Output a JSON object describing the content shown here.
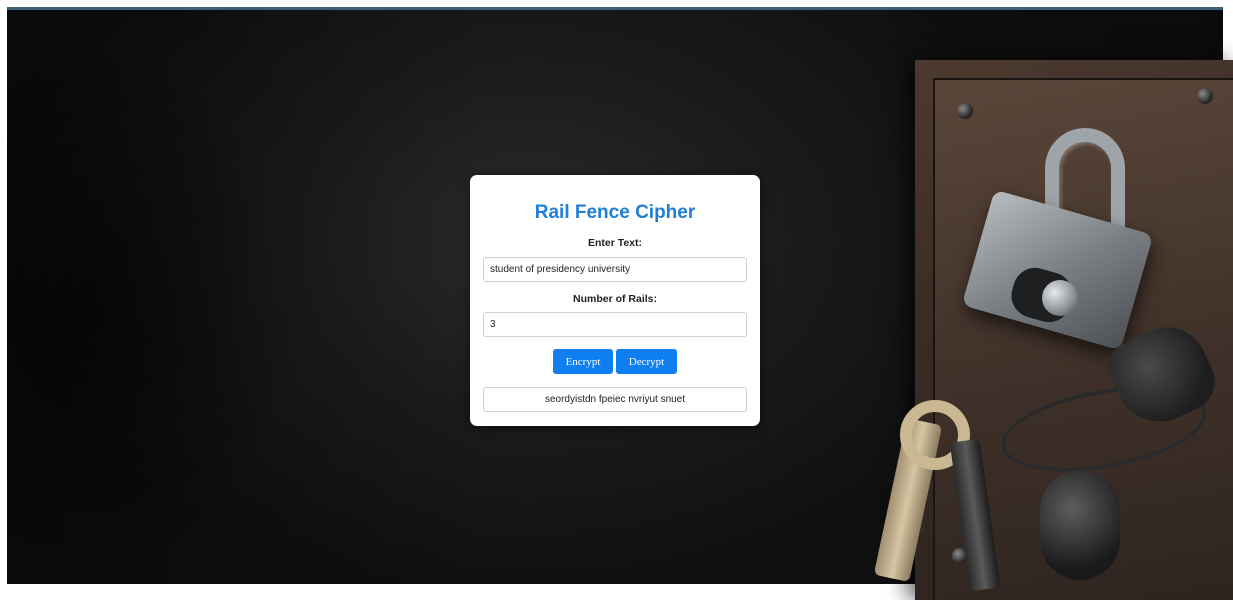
{
  "app": {
    "title": "Rail Fence Cipher"
  },
  "form": {
    "text_label": "Enter Text:",
    "text_value": "student of presidency university",
    "rails_label": "Number of Rails:",
    "rails_value": "3"
  },
  "actions": {
    "encrypt_label": "Encrypt",
    "decrypt_label": "Decrypt"
  },
  "result": {
    "output": "seordyistdn fpeiec nvriyut snuet"
  },
  "colors": {
    "title": "#1f7fd4",
    "button": "#0e7ef0",
    "card": "#ffffff",
    "background": "#1c1c1c"
  },
  "background": {
    "image_icons": [
      "padlock-icon",
      "key-icon"
    ]
  }
}
